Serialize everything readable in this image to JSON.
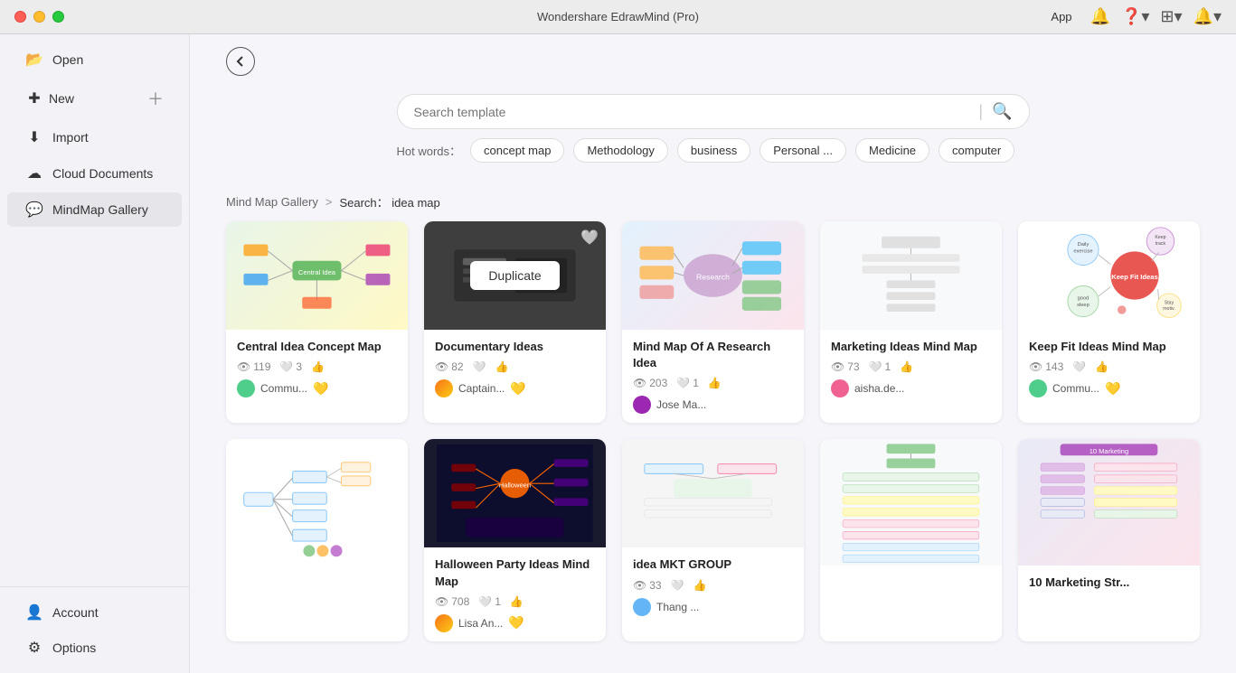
{
  "app": {
    "title": "Wondershare EdrawMind (Pro)"
  },
  "titlebar": {
    "traffic": [
      "close",
      "minimize",
      "maximize"
    ]
  },
  "toolbar": {
    "app_label": "App",
    "back_label": "←"
  },
  "sidebar": {
    "items": [
      {
        "id": "open",
        "label": "Open",
        "icon": "📂"
      },
      {
        "id": "new",
        "label": "New",
        "icon": "➕",
        "has_plus": true
      },
      {
        "id": "import",
        "label": "Import",
        "icon": "☁"
      },
      {
        "id": "cloud",
        "label": "Cloud Documents",
        "icon": "☁"
      },
      {
        "id": "mindmap",
        "label": "MindMap Gallery",
        "icon": "💬",
        "active": true
      }
    ],
    "bottom_items": [
      {
        "id": "account",
        "label": "Account",
        "icon": "👤"
      },
      {
        "id": "options",
        "label": "Options",
        "icon": "⚙"
      }
    ]
  },
  "search": {
    "placeholder": "Search template",
    "value": ""
  },
  "hot_words": {
    "label": "Hot words：",
    "tags": [
      "concept map",
      "Methodology",
      "business",
      "Personal ...",
      "Medicine",
      "computer"
    ]
  },
  "breadcrumb": {
    "link_label": "Mind Map Gallery",
    "separator": ">",
    "current": "Search： idea map"
  },
  "cards": [
    {
      "id": "central-idea",
      "title": "Central Idea Concept Map",
      "views": "119",
      "likes": "3",
      "thumb_type": "central",
      "author": "Commu...",
      "has_badge": true,
      "badge_type": "gold"
    },
    {
      "id": "documentary",
      "title": "Documentary Ideas",
      "views": "82",
      "likes": "0",
      "thumb_type": "documentary",
      "author": "Captain...",
      "has_badge": true,
      "badge_type": "gold",
      "show_duplicate": true
    },
    {
      "id": "research",
      "title": "Mind Map Of A Research Idea",
      "views": "203",
      "likes": "1",
      "thumb_type": "research",
      "author": "Jose Ma...",
      "has_badge": false
    },
    {
      "id": "marketing-ideas",
      "title": "Marketing Ideas Mind Map",
      "views": "73",
      "likes": "1",
      "thumb_type": "marketing",
      "author": "aisha.de...",
      "has_badge": false
    },
    {
      "id": "keepfit",
      "title": "Keep Fit Ideas Mind Map",
      "views": "143",
      "likes": "0",
      "thumb_type": "keepfit",
      "author": "Commu...",
      "has_badge": true,
      "badge_type": "gold"
    },
    {
      "id": "mindmap-tree",
      "title": "",
      "views": "",
      "likes": "",
      "thumb_type": "mindmap2",
      "author": "",
      "has_badge": false
    },
    {
      "id": "halloween",
      "title": "Halloween Party Ideas Mind Map",
      "views": "708",
      "likes": "1",
      "thumb_type": "halloween",
      "author": "Lisa An...",
      "has_badge": true,
      "badge_type": "gold"
    },
    {
      "id": "mkt-group",
      "title": "idea MKT GROUP",
      "views": "33",
      "likes": "0",
      "thumb_type": "mkt",
      "author": "Thang ...",
      "has_badge": false
    },
    {
      "id": "marketing2",
      "title": "",
      "views": "",
      "likes": "",
      "thumb_type": "marketing2",
      "author": "",
      "has_badge": false
    },
    {
      "id": "marketing3",
      "title": "10 Marketing Str...",
      "views": "",
      "likes": "",
      "thumb_type": "marketing3",
      "author": "",
      "has_badge": false
    }
  ],
  "duplicate_label": "Duplicate"
}
